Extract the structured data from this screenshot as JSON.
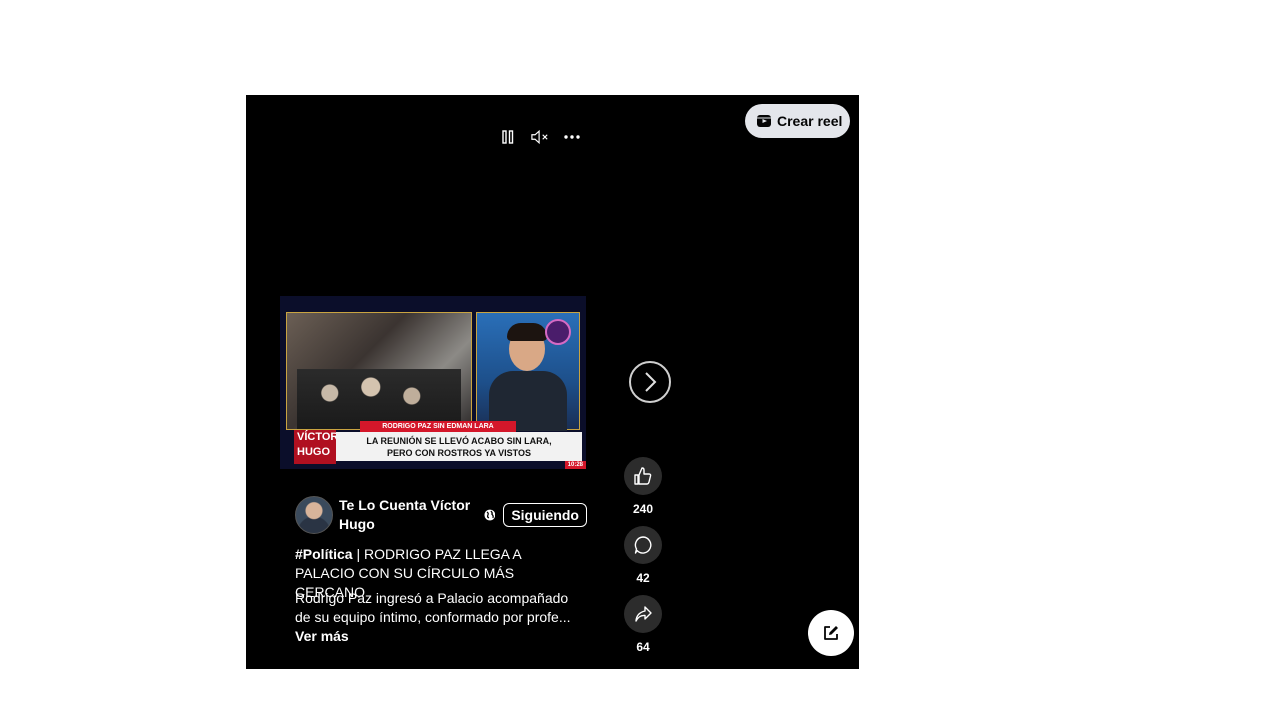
{
  "header": {
    "create_reel_label": "Crear reel"
  },
  "controls": {
    "pause_icon": "pause-icon",
    "mute_icon": "muted-speaker-icon",
    "more_icon": "more-horizontal-icon"
  },
  "video": {
    "red_banner": "RODRIGO PAZ SIN EDMAN LARA",
    "brand_line1": "VÍCTOR",
    "brand_line2": "HUGO",
    "headline_line1": "LA REUNIÓN SE LLEVÓ ACABO SIN LARA,",
    "headline_line2": "PERO CON ROSTROS YA VISTOS",
    "time": "10:28"
  },
  "post": {
    "author": "Te Lo Cuenta Víctor Hugo",
    "follow_label": "Siguiendo",
    "hashtag": "#Política",
    "title_rest": " | RODRIGO PAZ LLEGA A PALACIO CON SU CÍRCULO MÁS CERCANO",
    "description": "Rodrigo Paz ingresó a Palacio acompañado de su equipo íntimo, conformado por profe...",
    "see_more": "Ver más"
  },
  "actions": {
    "likes": "240",
    "comments": "42",
    "shares": "64"
  },
  "colors": {
    "background": "#000000",
    "pill": "#e4e6eb",
    "action_circle": "#2c2c2c"
  }
}
